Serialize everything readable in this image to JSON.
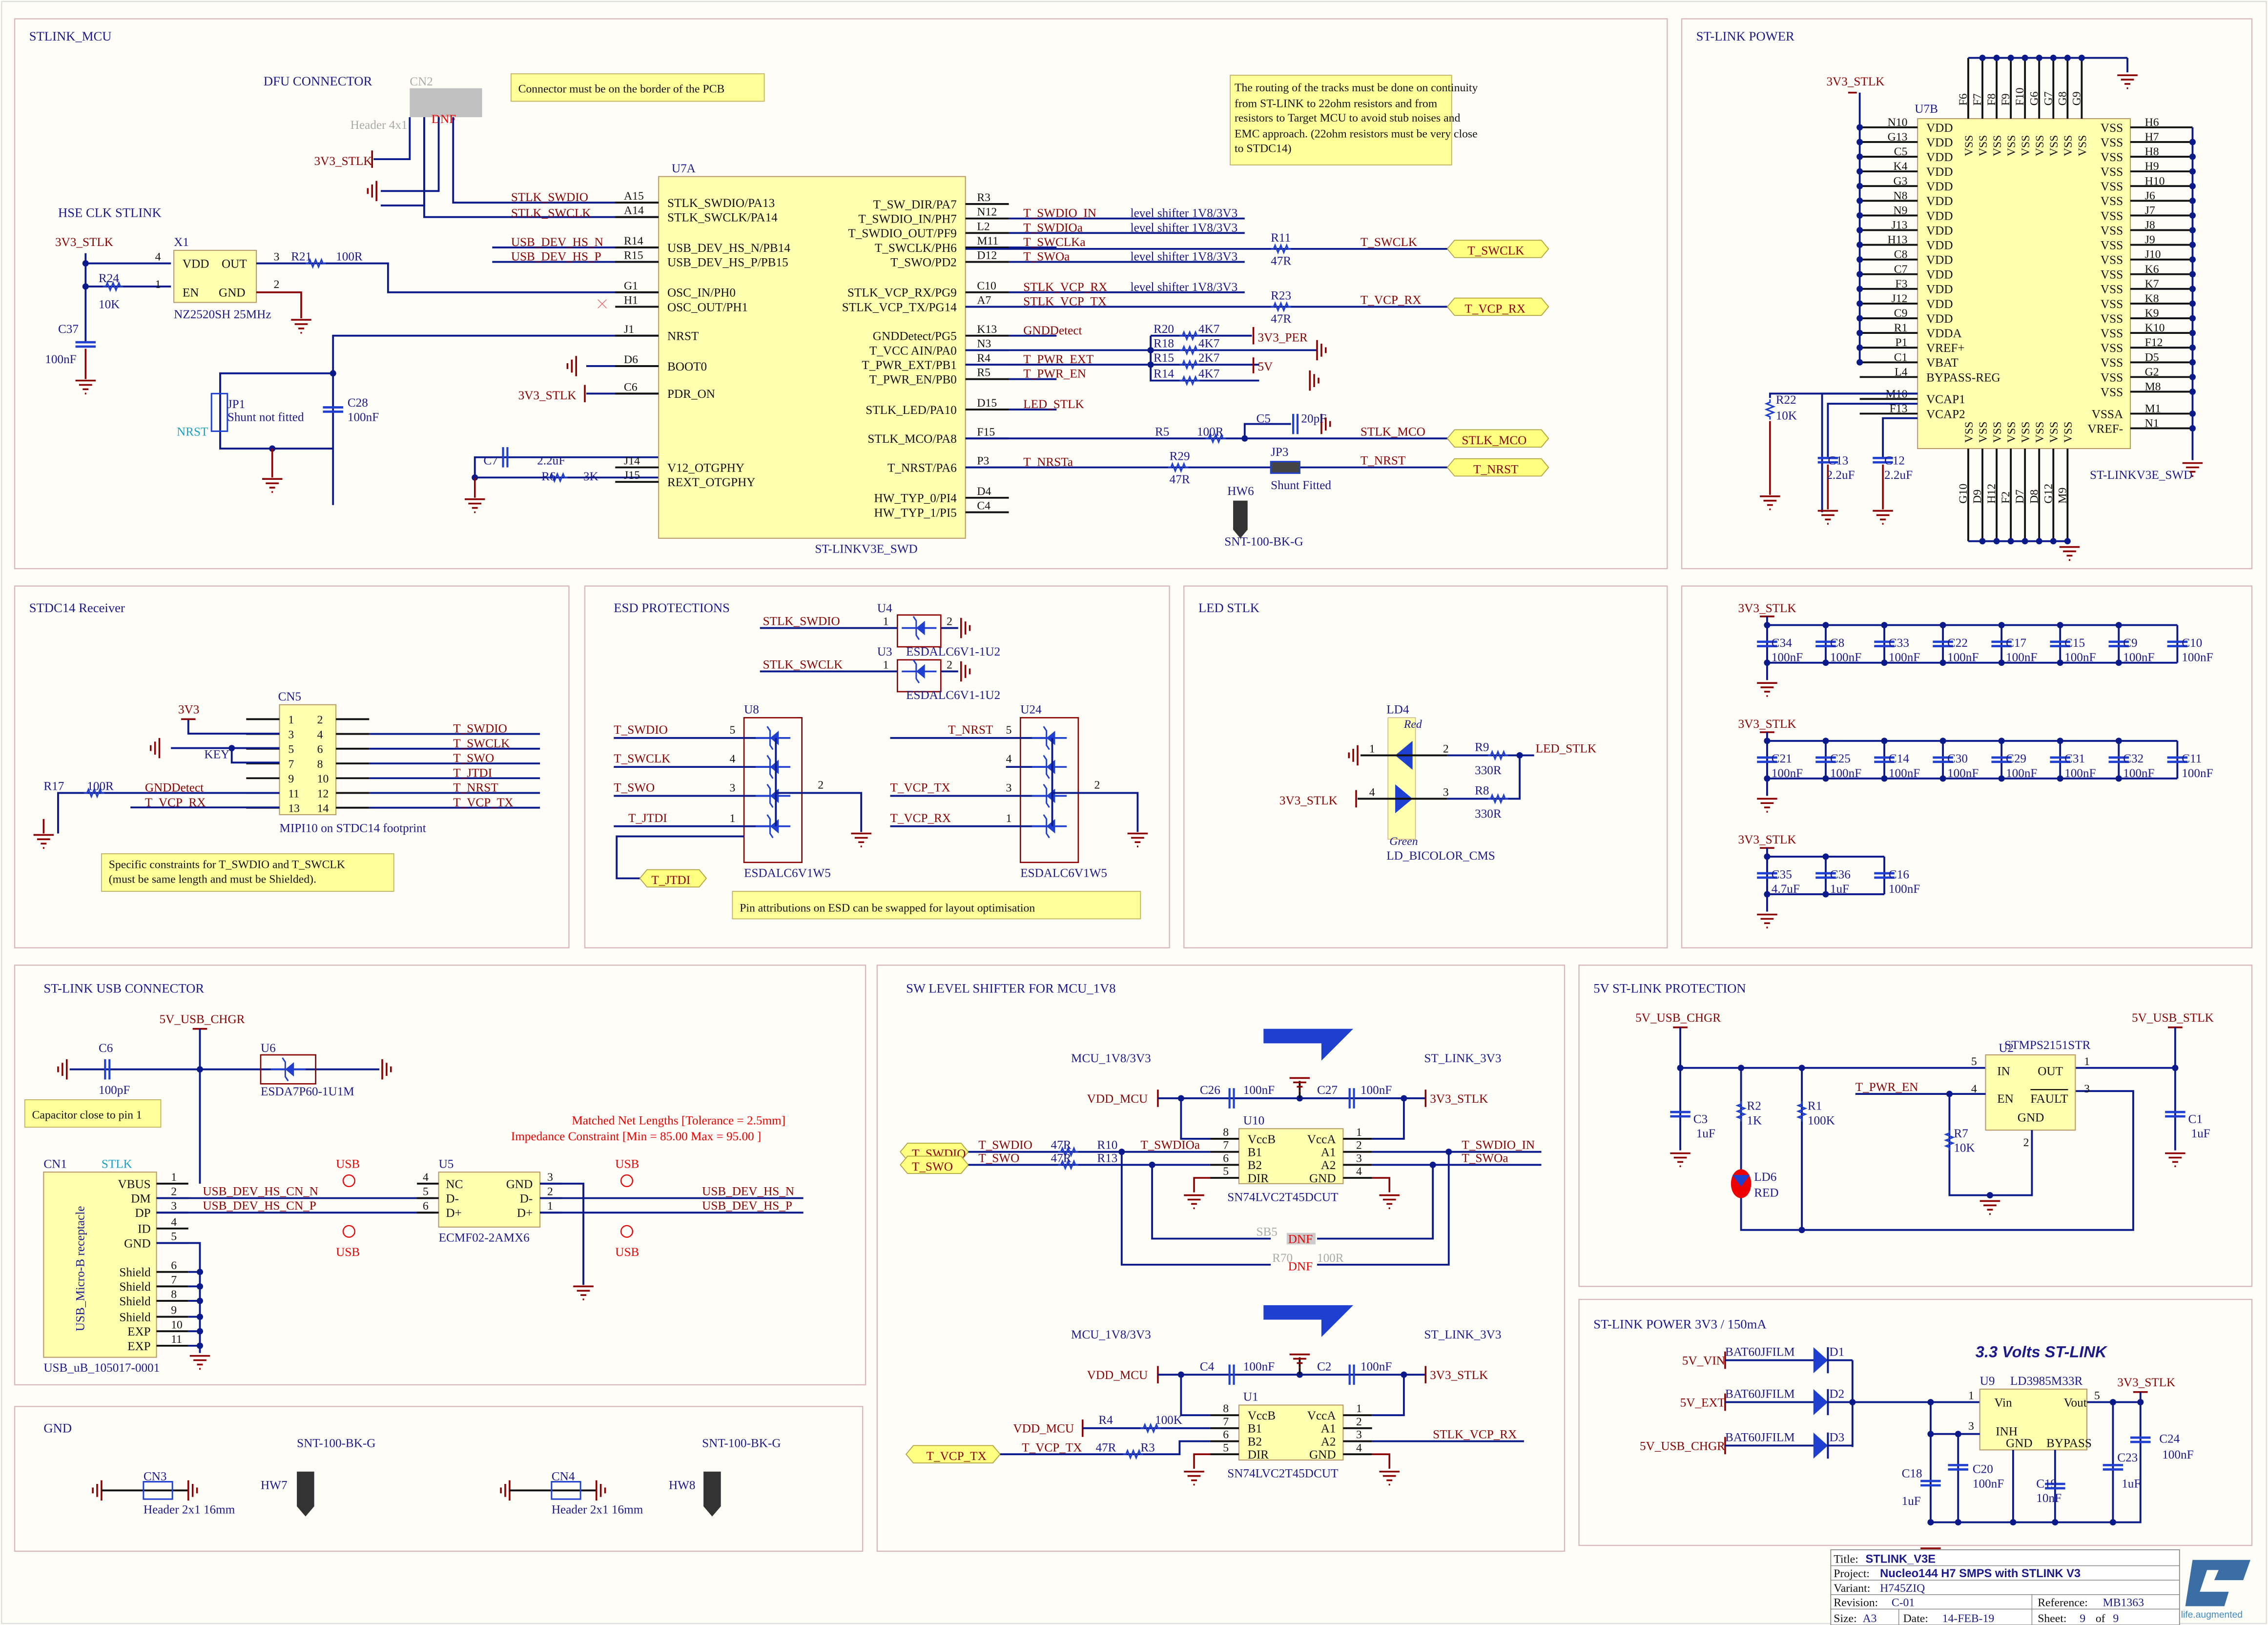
{
  "sheet": {
    "title_label": "Title:",
    "title": "STLINK_V3E",
    "project_label": "Project:",
    "project": "Nucleo144 H7 SMPS with STLINK V3",
    "variant_label": "Variant:",
    "variant": "H745ZIQ",
    "revision_label": "Revision:",
    "revision": "C-01",
    "reference_label": "Reference:",
    "reference": "MB1363",
    "size_label": "Size:",
    "size": "A3",
    "date_label": "Date:",
    "date": "14-FEB-19",
    "sheet_label": "Sheet:",
    "sheet_num": "9",
    "sheet_of": "of",
    "sheet_total": "9",
    "logo_tagline": "life.augmented"
  },
  "stlink_mcu": {
    "title": "STLINK_MCU",
    "dfu_title": "DFU CONNECTOR",
    "cn2": "CN2",
    "cn2_part": "Header 4x1",
    "dnf": "DNF",
    "note1": "Connector must be on the border of the PCB",
    "note2_lines": [
      "The routing of the tracks must be done on continuity",
      "from ST-LINK to 22ohm resistors and from",
      "resistors to Target MCU to avoid stub noises and",
      "EMC approach. (22ohm resistors must be very close",
      "to STDC14)"
    ],
    "hse_title": "HSE CLK STLINK",
    "v33": "3V3_STLK",
    "x1": "X1",
    "x1_part": "NZ2520SH 25MHz",
    "x1_pins": {
      "vdd": "VDD",
      "out": "OUT",
      "en": "EN",
      "gnd": "GND",
      "p4": "4",
      "p3": "3",
      "p1": "1",
      "p2": "2"
    },
    "r21": "R21",
    "r21_val": "100R",
    "r24": "R24",
    "r24_val": "10K",
    "c37": "C37",
    "c37_val": "100nF",
    "jp1": "JP1",
    "jp1_note": "Shunt not fitted",
    "nrst": "NRST",
    "c28": "C28",
    "c28_val": "100nF",
    "c7": "C7",
    "c7_val": "2.2uF",
    "r6": "R6",
    "r6_val": "3K",
    "u7a": "U7A",
    "u7a_part": "ST-LINKV3E_SWD",
    "left_pins": [
      {
        "ball": "A15",
        "name": "STLK_SWDIO/PA13",
        "net": "STLK_SWDIO"
      },
      {
        "ball": "A14",
        "name": "STLK_SWCLK/PA14",
        "net": "STLK_SWCLK"
      },
      {
        "ball": "R14",
        "name": "USB_DEV_HS_N/PB14",
        "net": "USB_DEV_HS_N"
      },
      {
        "ball": "R15",
        "name": "USB_DEV_HS_P/PB15",
        "net": "USB_DEV_HS_P"
      },
      {
        "ball": "G1",
        "name": "OSC_IN/PH0",
        "net": ""
      },
      {
        "ball": "H1",
        "name": "OSC_OUT/PH1",
        "net": ""
      },
      {
        "ball": "J1",
        "name": "NRST",
        "net": ""
      },
      {
        "ball": "D6",
        "name": "BOOT0",
        "net": ""
      },
      {
        "ball": "C6",
        "name": "PDR_ON",
        "net": "3V3_STLK"
      },
      {
        "ball": "J14",
        "name": "V12_OTGPHY",
        "net": ""
      },
      {
        "ball": "J15",
        "name": "REXT_OTGPHY",
        "net": ""
      }
    ],
    "right_pins": [
      {
        "ball": "R3",
        "name": "T_SW_DIR/PA7",
        "net": "",
        "note": ""
      },
      {
        "ball": "N12",
        "name": "T_SWDIO_IN/PH7",
        "net": "T_SWDIO_IN",
        "note": "level shifter 1V8/3V3"
      },
      {
        "ball": "L2",
        "name": "T_SWDIO_OUT/PF9",
        "net": "T_SWDIOa",
        "note": "level shifter 1V8/3V3"
      },
      {
        "ball": "M11",
        "name": "T_SWCLK/PH6",
        "net": "T_SWCLKa",
        "note": ""
      },
      {
        "ball": "D12",
        "name": "T_SWO/PD2",
        "net": "T_SWOa",
        "note": "level shifter 1V8/3V3"
      },
      {
        "ball": "C10",
        "name": "STLK_VCP_RX/PG9",
        "net": "STLK_VCP_RX",
        "note": "level shifter 1V8/3V3"
      },
      {
        "ball": "A7",
        "name": "STLK_VCP_TX/PG14",
        "net": "STLK_VCP_TX",
        "note": ""
      },
      {
        "ball": "K13",
        "name": "GNDDetect/PG5",
        "net": "GNDDetect",
        "note": ""
      },
      {
        "ball": "N3",
        "name": "T_VCC AIN/PA0",
        "net": "",
        "note": ""
      },
      {
        "ball": "R4",
        "name": "T_PWR_EXT/PB1",
        "net": "T_PWR_EXT",
        "note": ""
      },
      {
        "ball": "R5",
        "name": "T_PWR_EN/PB0",
        "net": "T_PWR_EN",
        "note": ""
      },
      {
        "ball": "D15",
        "name": "STLK_LED/PA10",
        "net": "LED_STLK",
        "note": ""
      },
      {
        "ball": "F15",
        "name": "STLK_MCO/PA8",
        "net": "",
        "note": ""
      },
      {
        "ball": "P3",
        "name": "T_NRST/PA6",
        "net": "T_NRSTa",
        "note": ""
      },
      {
        "ball": "D4",
        "name": "HW_TYP_0/PI4",
        "net": "",
        "note": ""
      },
      {
        "ball": "C4",
        "name": "HW_TYP_1/PI5",
        "net": "",
        "note": ""
      }
    ],
    "r11": "R11",
    "r11_val": "47R",
    "t_swclk": "T_SWCLK",
    "r23": "R23",
    "r23_val": "47R",
    "t_vcp_rx": "T_VCP_RX",
    "r20": "R20",
    "r20_val": "4K7",
    "r18": "R18",
    "r18_val": "4K7",
    "r15": "R15",
    "r15_val": "2K7",
    "r14": "R14",
    "r14_val": "4K7",
    "v33_per": "3V3_PER",
    "v5": "5V",
    "r5": "R5",
    "r5_val": "100R",
    "c5": "C5",
    "c5_val": "20pF",
    "stlk_mco": "STLK_MCO",
    "r29": "R29",
    "r29_val": "47R",
    "jp3": "JP3",
    "jp3_note": "Shunt Fitted",
    "t_nrst": "T_NRST",
    "hw6": "HW6",
    "hw6_part": "SNT-100-BK-G"
  },
  "stlink_power": {
    "title": "ST-LINK POWER",
    "v33": "3V3_STLK",
    "u7b": "U7B",
    "part": "ST-LINKV3E_SWD",
    "left": [
      {
        "ball": "N10",
        "name": "VDD"
      },
      {
        "ball": "G13",
        "name": "VDD"
      },
      {
        "ball": "C5",
        "name": "VDD"
      },
      {
        "ball": "K4",
        "name": "VDD"
      },
      {
        "ball": "G3",
        "name": "VDD"
      },
      {
        "ball": "N8",
        "name": "VDD"
      },
      {
        "ball": "N9",
        "name": "VDD"
      },
      {
        "ball": "J13",
        "name": "VDD"
      },
      {
        "ball": "H13",
        "name": "VDD"
      },
      {
        "ball": "C8",
        "name": "VDD"
      },
      {
        "ball": "C7",
        "name": "VDD"
      },
      {
        "ball": "F3",
        "name": "VDD"
      },
      {
        "ball": "J12",
        "name": "VDD"
      },
      {
        "ball": "C9",
        "name": "VDD"
      },
      {
        "ball": "R1",
        "name": "VDDA"
      },
      {
        "ball": "P1",
        "name": "VREF+"
      },
      {
        "ball": "C1",
        "name": "VBAT"
      },
      {
        "ball": "L4",
        "name": "BYPASS-REG"
      },
      {
        "ball": "M10",
        "name": "VCAP1"
      },
      {
        "ball": "F13",
        "name": "VCAP2"
      }
    ],
    "right": [
      {
        "ball": "H6",
        "name": "VSS"
      },
      {
        "ball": "H7",
        "name": "VSS"
      },
      {
        "ball": "H8",
        "name": "VSS"
      },
      {
        "ball": "H9",
        "name": "VSS"
      },
      {
        "ball": "H10",
        "name": "VSS"
      },
      {
        "ball": "J6",
        "name": "VSS"
      },
      {
        "ball": "J7",
        "name": "VSS"
      },
      {
        "ball": "J8",
        "name": "VSS"
      },
      {
        "ball": "J9",
        "name": "VSS"
      },
      {
        "ball": "J10",
        "name": "VSS"
      },
      {
        "ball": "K6",
        "name": "VSS"
      },
      {
        "ball": "K7",
        "name": "VSS"
      },
      {
        "ball": "K8",
        "name": "VSS"
      },
      {
        "ball": "K9",
        "name": "VSS"
      },
      {
        "ball": "K10",
        "name": "VSS"
      },
      {
        "ball": "F12",
        "name": "VSS"
      },
      {
        "ball": "D5",
        "name": "VSS"
      },
      {
        "ball": "G2",
        "name": "VSS"
      },
      {
        "ball": "M8",
        "name": "VSS"
      },
      {
        "ball": "M1",
        "name": "VSSA"
      },
      {
        "ball": "N1",
        "name": "VREF-"
      }
    ],
    "top": [
      "F6",
      "F7",
      "F8",
      "F9",
      "F10",
      "G6",
      "G7",
      "G8",
      "G9"
    ],
    "bottom": [
      "G10",
      "D9",
      "H12",
      "F2",
      "D7",
      "D8",
      "G12",
      "M9"
    ],
    "vss": "VSS",
    "r22": "R22",
    "r22_val": "10K",
    "c13": "C13",
    "c13_val": "2.2uF",
    "c12": "C12",
    "c12_val": "2.2uF"
  },
  "decoupling": {
    "rail": "3V3_STLK",
    "row1": [
      {
        "ref": "C34",
        "val": "100nF"
      },
      {
        "ref": "C8",
        "val": "100nF"
      },
      {
        "ref": "C33",
        "val": "100nF"
      },
      {
        "ref": "C22",
        "val": "100nF"
      },
      {
        "ref": "C17",
        "val": "100nF"
      },
      {
        "ref": "C15",
        "val": "100nF"
      },
      {
        "ref": "C9",
        "val": "100nF"
      },
      {
        "ref": "C10",
        "val": "100nF"
      }
    ],
    "row2": [
      {
        "ref": "C21",
        "val": "100nF"
      },
      {
        "ref": "C25",
        "val": "100nF"
      },
      {
        "ref": "C14",
        "val": "100nF"
      },
      {
        "ref": "C30",
        "val": "100nF"
      },
      {
        "ref": "C29",
        "val": "100nF"
      },
      {
        "ref": "C31",
        "val": "100nF"
      },
      {
        "ref": "C32",
        "val": "100nF"
      },
      {
        "ref": "C11",
        "val": "100nF"
      }
    ],
    "row3": [
      {
        "ref": "C35",
        "val": "4.7uF"
      },
      {
        "ref": "C36",
        "val": "1uF"
      },
      {
        "ref": "C16",
        "val": "100nF"
      }
    ]
  },
  "stdc14": {
    "title": "STDC14 Receiver",
    "cn5": "CN5",
    "part": "MIPI10 on STDC14 footprint",
    "v33": "3V3",
    "key": "KEY",
    "r17": "R17",
    "r17_val": "100R",
    "pins_left": [
      "1",
      "3",
      "5",
      "7",
      "9",
      "11",
      "13"
    ],
    "pins_right": [
      "2",
      "4",
      "6",
      "8",
      "10",
      "12",
      "14"
    ],
    "left_nets": [
      "",
      "",
      "",
      "",
      "",
      "GNDDetect",
      "T_VCP_RX"
    ],
    "right_nets": [
      "",
      "T_SWDIO",
      "T_SWCLK",
      "T_SWO",
      "T_JTDI",
      "T_NRST",
      "T_VCP_TX"
    ],
    "note_lines": [
      "Specific constraints for T_SWDIO and T_SWCLK",
      "(must be same length and must be Shielded)."
    ]
  },
  "esd": {
    "title": "ESD PROTECTIONS",
    "u4": "U4",
    "u3": "U3",
    "u4_part": "ESDALC6V1-1U2",
    "u3_part": "ESDALC6V1-1U2",
    "u4_net": "STLK_SWDIO",
    "u3_net": "STLK_SWCLK",
    "u8": "U8",
    "u24": "U24",
    "w5_part": "ESDALC6V1W5",
    "u8_pins": [
      {
        "net": "T_SWDIO",
        "pin": "5"
      },
      {
        "net": "T_SWCLK",
        "pin": "4"
      },
      {
        "net": "T_SWO",
        "pin": "3"
      },
      {
        "net": "T_JTDI",
        "pin": "1"
      }
    ],
    "u24_pins": [
      {
        "net": "T_NRST",
        "pin": "5"
      },
      {
        "net": "",
        "pin": "4"
      },
      {
        "net": "T_VCP_TX",
        "pin": "3"
      },
      {
        "net": "T_VCP_RX",
        "pin": "1"
      }
    ],
    "gnd_pin": "2",
    "t_jtdi_port": "T_JTDI",
    "note": "Pin attributions on ESD can be swapped for layout optimisation",
    "p1": "1",
    "p2": "2"
  },
  "led": {
    "title": "LED STLK",
    "ld4": "LD4",
    "red": "Red",
    "green": "Green",
    "part": "LD_BICOLOR_CMS",
    "r9": "R9",
    "r9_val": "330R",
    "r8": "R8",
    "r8_val": "330R",
    "net": "LED_STLK",
    "v33": "3V3_STLK",
    "p1": "1",
    "p2": "2",
    "p3": "3",
    "p4": "4"
  },
  "usb": {
    "title": "ST-LINK USB CONNECTOR",
    "rail": "5V_USB_CHGR",
    "c6": "C6",
    "c6_val": "100pF",
    "u6": "U6",
    "u6_part": "ESDA7P60-1U1M",
    "note": "Capacitor close to pin 1",
    "constraint1": "Matched Net Lengths [Tolerance = 2.5mm]",
    "constraint2": "Impedance Constraint [Min = 85.00    Max = 95.00    ]",
    "cn1": "CN1",
    "stlk": "STLK",
    "cn1_body": "USB_Micro-B receptacle",
    "cn1_part": "USB_uB_105017-0001",
    "cn1_pins": [
      {
        "n": "1",
        "name": "VBUS"
      },
      {
        "n": "2",
        "name": "DM"
      },
      {
        "n": "3",
        "name": "DP"
      },
      {
        "n": "4",
        "name": "ID"
      },
      {
        "n": "5",
        "name": "GND"
      },
      {
        "n": "6",
        "name": "Shield"
      },
      {
        "n": "7",
        "name": "Shield"
      },
      {
        "n": "8",
        "name": "Shield"
      },
      {
        "n": "9",
        "name": "Shield"
      },
      {
        "n": "10",
        "name": "EXP"
      },
      {
        "n": "11",
        "name": "EXP"
      }
    ],
    "cn_n": "USB_DEV_HS_CN_N",
    "cn_p": "USB_DEV_HS_CN_P",
    "usb_tag": "USB",
    "u5": "U5",
    "u5_part": "ECMF02-2AMX6",
    "u5_left": [
      {
        "n": "4",
        "name": "NC"
      },
      {
        "n": "5",
        "name": "D-"
      },
      {
        "n": "6",
        "name": "D+"
      }
    ],
    "u5_right": [
      {
        "n": "3",
        "name": "GND"
      },
      {
        "n": "2",
        "name": "D-"
      },
      {
        "n": "1",
        "name": "D+"
      }
    ],
    "hs_n": "USB_DEV_HS_N",
    "hs_p": "USB_DEV_HS_P"
  },
  "level_shifter": {
    "title": "SW LEVEL SHIFTER FOR MCU_1V8",
    "mcu_side": "MCU_1V8/3V3",
    "stlink_side": "ST_LINK_3V3",
    "vdd_mcu": "VDD_MCU",
    "v33": "3V3_STLK",
    "u10": "U10",
    "u1": "U1",
    "part": "SN74LVC2T45DCUT",
    "chip_left": [
      {
        "n": "8",
        "name": "VccB"
      },
      {
        "n": "7",
        "name": "B1"
      },
      {
        "n": "6",
        "name": "B2"
      },
      {
        "n": "5",
        "name": "DIR"
      }
    ],
    "chip_right": [
      {
        "n": "1",
        "name": "VccA"
      },
      {
        "n": "2",
        "name": "A1"
      },
      {
        "n": "3",
        "name": "A2"
      },
      {
        "n": "4",
        "name": "GND"
      }
    ],
    "c26": "C26",
    "c26_val": "100nF",
    "c27": "C27",
    "c27_val": "100nF",
    "c4": "C4",
    "c4_val": "100nF",
    "c2": "C2",
    "c2_val": "100nF",
    "t_swdio": "T_SWDIO",
    "t_swo": "T_SWO",
    "r10": "R10",
    "r10_val": "47R",
    "r13": "R13",
    "r13_val": "47R",
    "t_swdioa": "T_SWDIOa",
    "t_swdio_in": "T_SWDIO_IN",
    "t_swoa": "T_SWOa",
    "sb5": "SB5",
    "r70": "R70",
    "r70_val": "100R",
    "dnf": "DNF",
    "r4": "R4",
    "r4_val": "100K",
    "t_vcp_tx": "T_VCP_TX",
    "r3": "R3",
    "r3_val": "47R",
    "stlk_vcp_rx": "STLK_VCP_RX"
  },
  "protection_5v": {
    "title": "5V ST-LINK PROTECTION",
    "in_rail": "5V_USB_CHGR",
    "out_rail": "5V_USB_STLK",
    "u2": "U2",
    "part": "STMPS2151STR",
    "pins": {
      "in": "IN",
      "out": "OUT",
      "en": "EN",
      "fault": "FAULT",
      "gnd": "GND",
      "p5": "5",
      "p1": "1",
      "p4": "4",
      "p3": "3",
      "p2": "2"
    },
    "c3": "C3",
    "c3_val": "1uF",
    "r2": "R2",
    "r2_val": "1K",
    "r1": "R1",
    "r1_val": "100K",
    "r7": "R7",
    "r7_val": "10K",
    "ld6": "LD6",
    "ld6_color": "RED",
    "t_pwr_en": "T_PWR_EN",
    "c1": "C1",
    "c1_val": "1uF"
  },
  "power_3v3": {
    "title": "ST-LINK POWER 3V3 / 150mA",
    "banner": "3.3 Volts ST-LINK",
    "inputs": [
      {
        "net": "5V_VIN",
        "diode": "D1"
      },
      {
        "net": "5V_EXT",
        "diode": "D2"
      },
      {
        "net": "5V_USB_CHGR",
        "diode": "D3"
      }
    ],
    "diode_part": "BAT60JFILM",
    "u9": "U9",
    "part": "LD3985M33R",
    "out": "3V3_STLK",
    "pins": {
      "vin": "Vin",
      "vout": "Vout",
      "inh": "INH",
      "gnd": "GND",
      "bypass": "BYPASS",
      "p1": "1",
      "p5": "5",
      "p3": "3",
      "p2": "2",
      "p4": "4"
    },
    "c18": "C18",
    "c18_val": "1uF",
    "c20": "C20",
    "c20_val": "100nF",
    "c19": "C19",
    "c19_val": "10nF",
    "c23": "C23",
    "c23_val": "1uF",
    "c24": "C24",
    "c24_val": "100nF"
  },
  "gnd_section": {
    "title": "GND",
    "cn3": "CN3",
    "cn4": "CN4",
    "header": "Header 2x1 16mm",
    "hw7": "HW7",
    "hw8": "HW8",
    "part": "SNT-100-BK-G"
  }
}
